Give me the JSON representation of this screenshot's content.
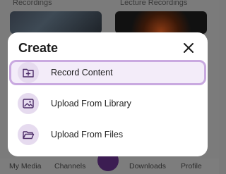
{
  "background": {
    "card_titles": [
      "Recordings",
      "Lecture Recordings"
    ],
    "nav": [
      "My Media",
      "Channels",
      "Downloads",
      "Profile"
    ]
  },
  "dialog": {
    "title": "Create",
    "close_icon": "close-icon",
    "options": [
      {
        "label": "Record Content",
        "icon": "add-folder-icon",
        "selected": true
      },
      {
        "label": "Upload From Library",
        "icon": "image-icon",
        "selected": false
      },
      {
        "label": "Upload From Files",
        "icon": "folder-open-icon",
        "selected": false
      }
    ]
  },
  "colors": {
    "accent": "#c9a9e0",
    "icon_bg": "#e6dbef",
    "icon_stroke": "#4a2a66",
    "overlay": "#7b7b7b"
  }
}
